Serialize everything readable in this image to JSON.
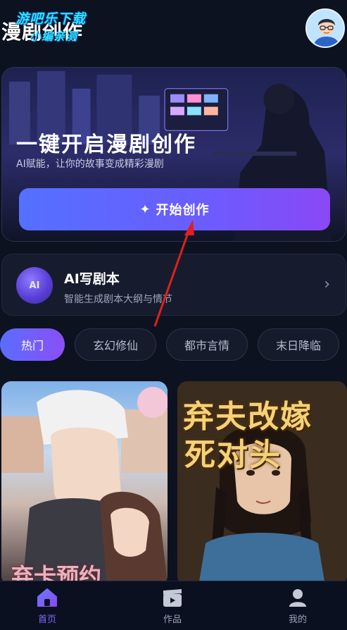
{
  "header": {
    "app_title": "漫剧创作",
    "watermark_line1": "游吧乐下载",
    "watermark_line2": "小编亲测",
    "avatar_icon": "user-avatar-icon"
  },
  "hero": {
    "title": "一键开启漫剧创作",
    "subtitle": "AI赋能，让你的故事变成精彩漫剧",
    "button_icon": "sparkle-icon",
    "button_label": "开始创作"
  },
  "script_card": {
    "badge_text": "AI",
    "title": "AI写剧本",
    "subtitle": "智能生成剧本大纲与情节",
    "chevron_icon": "chevron-right-icon"
  },
  "tabs": [
    {
      "label": "热门",
      "active": true
    },
    {
      "label": "玄幻修仙",
      "active": false
    },
    {
      "label": "都市言情",
      "active": false
    },
    {
      "label": "末日降临",
      "active": false
    }
  ],
  "posters": [
    {
      "title_text": "弃卡预约"
    },
    {
      "title_line1": "弃夫改嫁",
      "title_line2": "死对头"
    }
  ],
  "bottom_nav": [
    {
      "label": "首页",
      "icon": "home-icon",
      "active": true
    },
    {
      "label": "作品",
      "icon": "clapperboard-icon",
      "active": false
    },
    {
      "label": "我的",
      "icon": "profile-icon",
      "active": false
    }
  ],
  "colors": {
    "background": "#0d1220",
    "accent_start": "#5470ff",
    "accent_end": "#8a48f4",
    "annotation_arrow": "#e0201a"
  }
}
